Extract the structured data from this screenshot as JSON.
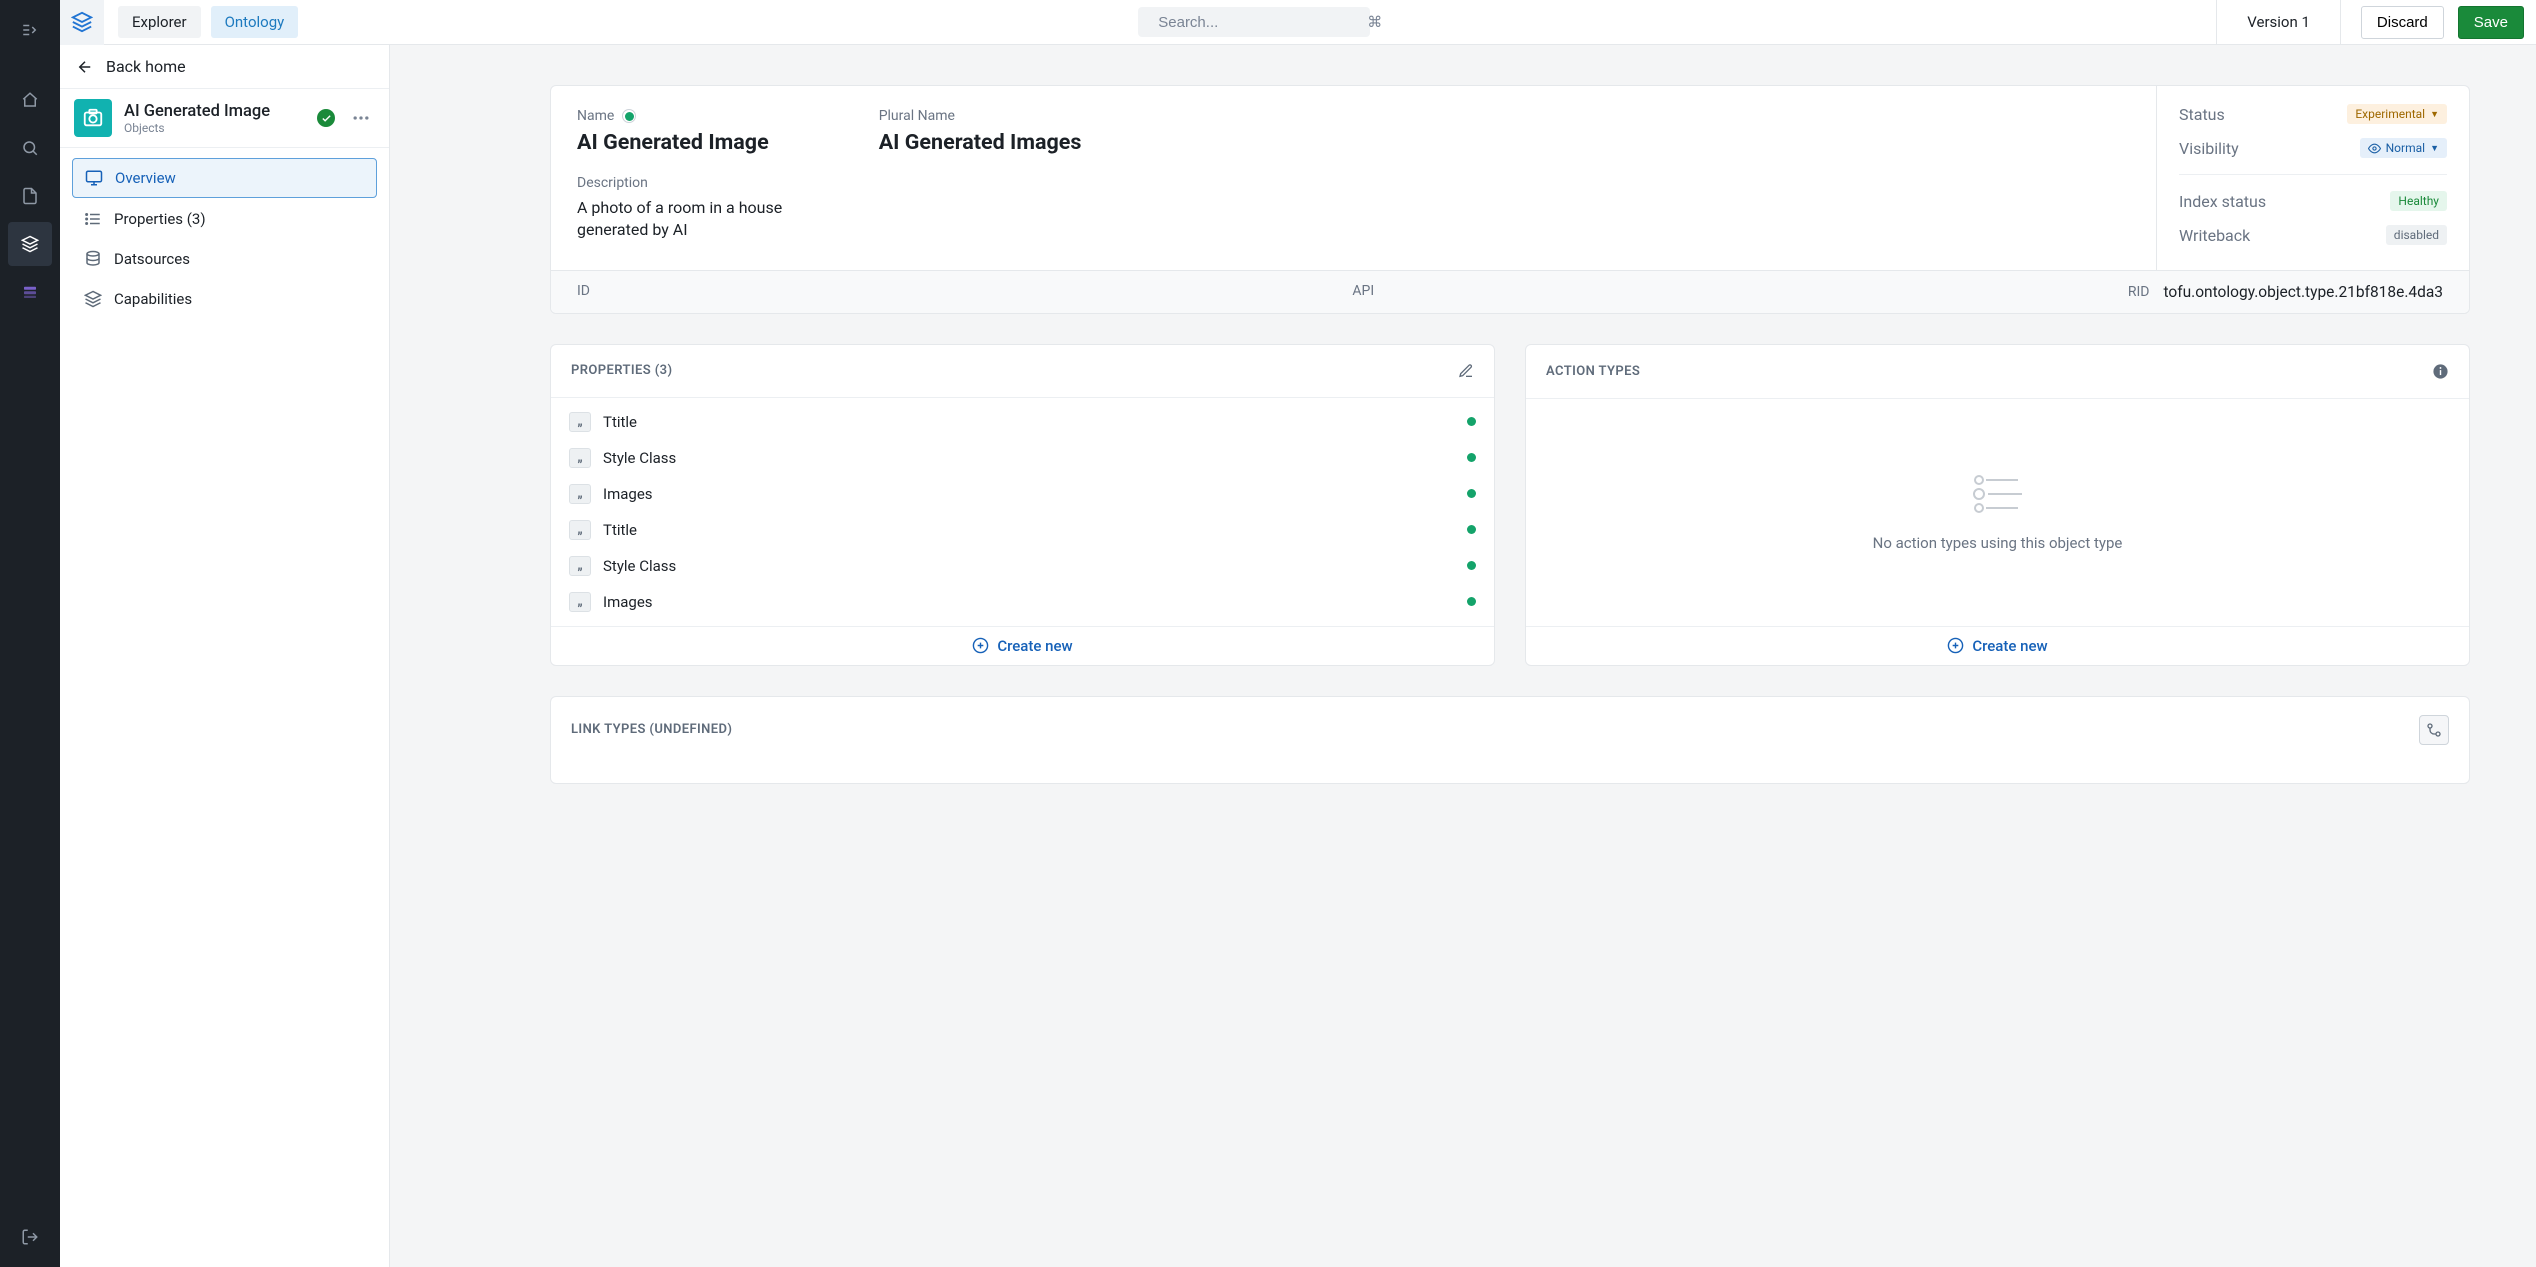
{
  "topbar": {
    "tabs": {
      "explorer": "Explorer",
      "ontology": "Ontology"
    },
    "search_placeholder": "Search...",
    "shortcut": "⌘",
    "version": "Version 1",
    "discard": "Discard",
    "save": "Save"
  },
  "sidebar": {
    "back": "Back home",
    "object_title": "AI Generated Image",
    "object_subtitle": "Objects",
    "items": [
      {
        "label": "Overview"
      },
      {
        "label": "Properties (3)"
      },
      {
        "label": "Datsources"
      },
      {
        "label": "Capabilities"
      }
    ]
  },
  "overview": {
    "name_label": "Name",
    "name_value": "AI Generated Image",
    "plural_label": "Plural Name",
    "plural_value": "AI Generated Images",
    "desc_label": "Description",
    "desc_value": "A photo of a room in a house generated by AI",
    "status_label": "Status",
    "status_value": "Experimental",
    "visibility_label": "Visibility",
    "visibility_value": "Normal",
    "index_label": "Index status",
    "index_value": "Healthy",
    "writeback_label": "Writeback",
    "writeback_value": "disabled",
    "id_label": "ID",
    "api_label": "API",
    "rid_label": "RID",
    "rid_value": "tofu.ontology.object.type.21bf818e.4da3"
  },
  "properties": {
    "header": "PROPERTIES (3)",
    "items": [
      {
        "label": "Ttitle"
      },
      {
        "label": "Style Class"
      },
      {
        "label": "Images"
      },
      {
        "label": "Ttitle"
      },
      {
        "label": "Style Class"
      },
      {
        "label": "Images"
      }
    ],
    "create": "Create new"
  },
  "action_types": {
    "header": "ACTION TYPES",
    "empty": "No action types using this object type",
    "create": "Create new"
  },
  "link_types": {
    "header": "LINK TYPES (UNDEFINED)"
  }
}
